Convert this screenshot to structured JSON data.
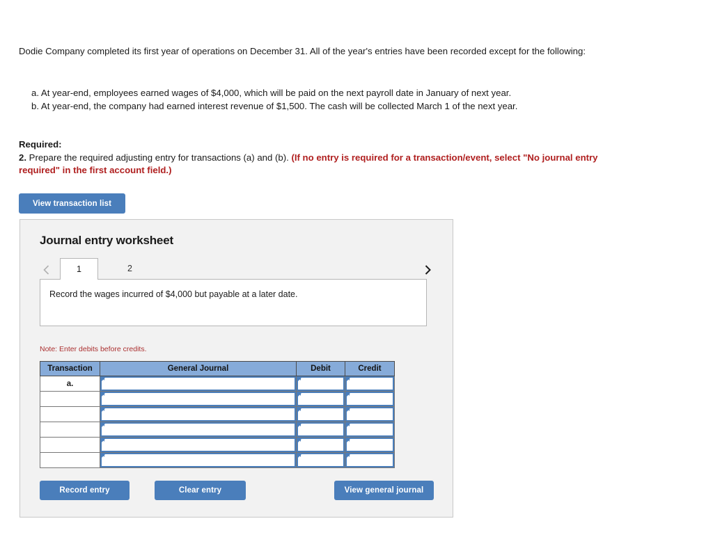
{
  "problem": {
    "intro": "Dodie Company completed its first year of operations on December 31. All of the year's entries have been recorded except for the following:",
    "items": [
      "a. At year-end, employees earned wages of $4,000, which will be paid on the next payroll date in January of next year.",
      "b. At year-end, the company had earned interest revenue of $1,500. The cash will be collected March 1 of the next year."
    ]
  },
  "required": {
    "label": "Required:",
    "number": "2.",
    "text": " Prepare the required adjusting entry for transactions (a) and (b). ",
    "emphasis": "(If no entry is required for a transaction/event, select \"No journal entry required\" in the first account field.)"
  },
  "toolbar": {
    "view_transaction_list_label": "View transaction list"
  },
  "worksheet": {
    "title": "Journal entry worksheet",
    "tabs": [
      {
        "label": "1",
        "active": true
      },
      {
        "label": "2",
        "active": false
      }
    ],
    "prev_icon": "chevron-left-icon",
    "next_icon": "chevron-right-icon",
    "description": "Record the wages incurred of $4,000 but payable at a later date.",
    "note": "Note: Enter debits before credits.",
    "table": {
      "headers": [
        "Transaction",
        "General Journal",
        "Debit",
        "Credit"
      ],
      "rows": [
        {
          "transaction": "a.",
          "general_journal": "",
          "debit": "",
          "credit": ""
        },
        {
          "transaction": "",
          "general_journal": "",
          "debit": "",
          "credit": ""
        },
        {
          "transaction": "",
          "general_journal": "",
          "debit": "",
          "credit": ""
        },
        {
          "transaction": "",
          "general_journal": "",
          "debit": "",
          "credit": ""
        },
        {
          "transaction": "",
          "general_journal": "",
          "debit": "",
          "credit": ""
        },
        {
          "transaction": "",
          "general_journal": "",
          "debit": "",
          "credit": ""
        }
      ]
    },
    "buttons": {
      "record_entry": "Record entry",
      "clear_entry": "Clear entry",
      "view_general_journal": "View general journal"
    }
  },
  "colors": {
    "button_blue": "#4a7ebb",
    "table_header_blue": "#86abd9",
    "note_red": "#ab3030",
    "emphasis_red": "#b02020",
    "panel_background": "#f2f2f2"
  }
}
